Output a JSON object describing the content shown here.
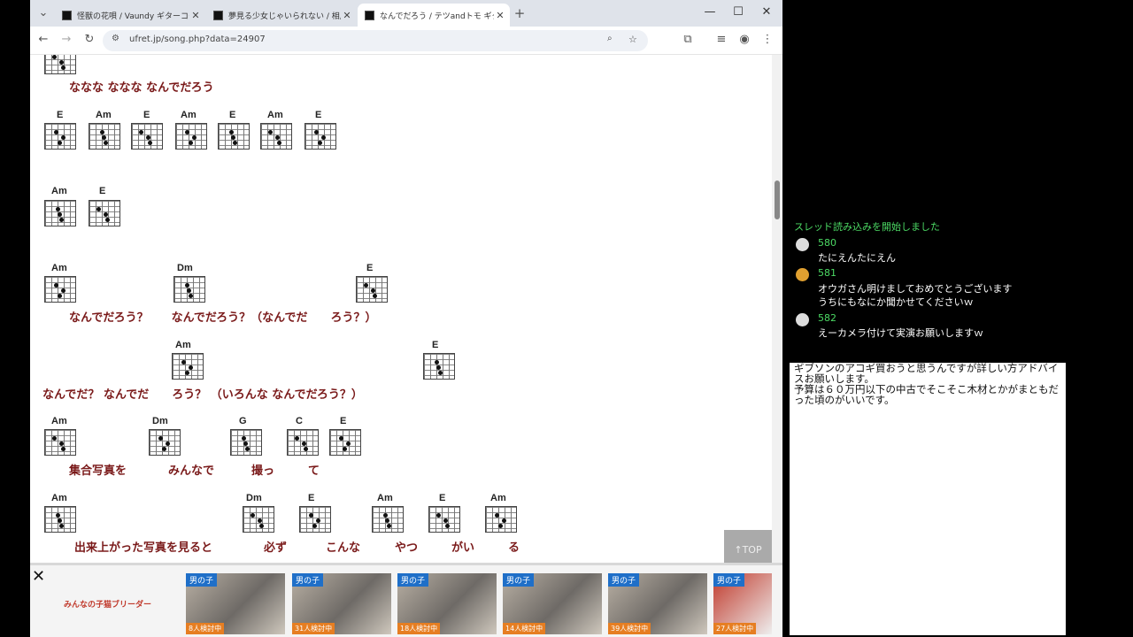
{
  "browser": {
    "tabs": [
      {
        "title": "怪獣の花唄 / Vaundy ギターコード/ウクレレ"
      },
      {
        "title": "夢見る少女じゃいられない / 相川七瀬"
      },
      {
        "title": "なんでだろう / テツandトモ ギターコード"
      }
    ],
    "new_tab": "+",
    "url": "ufret.jp/song.php?data=24907",
    "window": {
      "minimize": "—",
      "maximize": "☐",
      "close": "✕"
    },
    "nav": {
      "back": "←",
      "forward": "→",
      "reload": "↻"
    }
  },
  "song": {
    "lines": [
      {
        "lyric": "ななな ななな なんでだろう",
        "chords": []
      },
      {
        "lyric": "",
        "chords": [
          "E",
          "Am",
          "E",
          "Am",
          "E",
          "Am",
          "E"
        ]
      },
      {
        "lyric": "",
        "chords": [
          "Am",
          "E"
        ]
      },
      {
        "lyric": "なんでだろう？　　なんでだろう？（なんでだ　　ろう？）",
        "chords": [
          "Am",
          "Dm",
          "E"
        ]
      },
      {
        "lyric": "なんでだ？ なんでだ　　ろう？ （いろんな なんでだろう？）",
        "chords": [
          "Am",
          "E"
        ]
      },
      {
        "lyric_parts": [
          "集合写真を",
          "みんなで",
          "撮っ",
          "て"
        ],
        "chords": [
          "Am",
          "Dm",
          "G",
          "C",
          "E"
        ]
      },
      {
        "lyric_parts": [
          "出来上がった写真を見ると",
          "必ず",
          "こんな",
          "やつ",
          "がい",
          "る"
        ],
        "chords": [
          "Am",
          "Dm",
          "E",
          "Am",
          "E",
          "Am"
        ]
      }
    ],
    "top_button": "↑TOP"
  },
  "ad": {
    "close": "✕",
    "logo": "みんなの子猫ブリーダー",
    "cards": [
      {
        "badge": "男の子",
        "count": "8人検討中"
      },
      {
        "badge": "男の子",
        "count": "31人検討中"
      },
      {
        "badge": "男の子",
        "count": "18人検討中"
      },
      {
        "badge": "男の子",
        "count": "14人検討中"
      },
      {
        "badge": "男の子",
        "count": "39人検討中"
      },
      {
        "badge": "男の子",
        "count": "27人検討中"
      }
    ]
  },
  "chat": {
    "status": "スレッド読み込みを開始しました",
    "messages": [
      {
        "num": "580",
        "lines": [
          "たにえんたにえん"
        ]
      },
      {
        "num": "581",
        "lines": [
          "オウガさん明けましておめでとうございます",
          "うちにもなにか聞かせてくださいｗ"
        ]
      },
      {
        "num": "582",
        "lines": [
          "えーカメラ付けて実演お願いしますｗ"
        ]
      }
    ]
  },
  "post": {
    "text": "ギブソンのアコギ買おうと思うんですが詳しい方アドバイスお願いします。\n予算は６０万円以下の中古でそこそこ木材とかがまともだった頃のがいいです。"
  },
  "colors": {
    "lyric": "#7a1a1a",
    "chat_green": "#4cd964",
    "ad_badge": "#1f6fc8"
  }
}
